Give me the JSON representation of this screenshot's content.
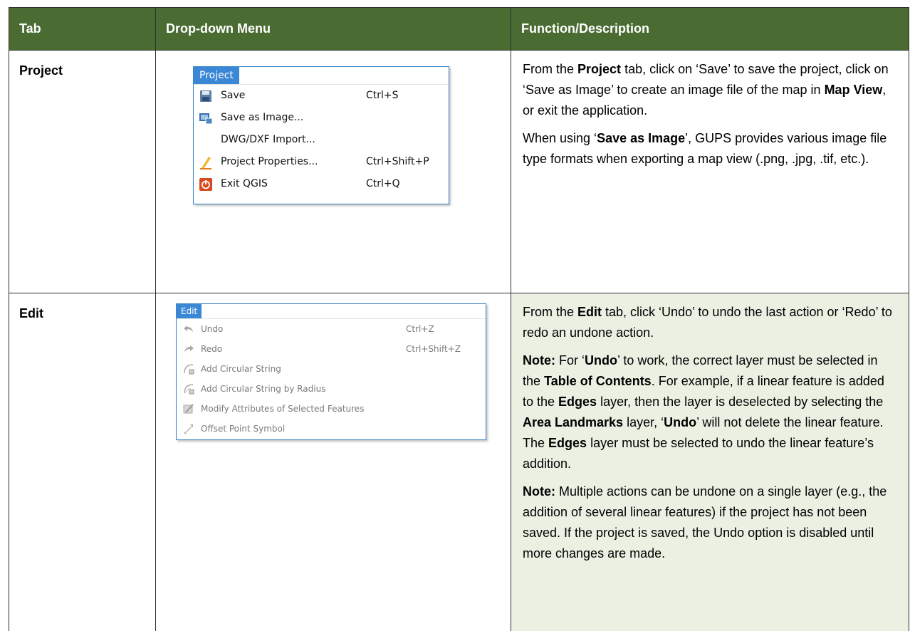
{
  "table": {
    "headers": [
      "Tab",
      "Drop-down Menu",
      "Function/Description"
    ]
  },
  "rows": {
    "project": {
      "tab": "Project",
      "menu": {
        "title": "Project",
        "items": [
          {
            "icon": "save-icon",
            "label": "Save",
            "shortcut": "Ctrl+S"
          },
          {
            "icon": "save-as-image-icon",
            "label": "Save as Image...",
            "shortcut": ""
          },
          {
            "icon": "",
            "label": "DWG/DXF Import...",
            "shortcut": ""
          },
          {
            "icon": "project-properties-icon",
            "label": "Project Properties...",
            "shortcut": "Ctrl+Shift+P"
          },
          {
            "icon": "exit-icon",
            "label": "Exit QGIS",
            "shortcut": "Ctrl+Q"
          }
        ]
      },
      "desc": {
        "p1": [
          {
            "text": "From the ",
            "bold": false
          },
          {
            "text": "Project",
            "bold": true
          },
          {
            "text": " tab, click on ‘Save’ to save the project, click on ‘Save as Image’ to create an image file of the map in ",
            "bold": false
          },
          {
            "text": "Map View",
            "bold": true
          },
          {
            "text": ", or exit the application.",
            "bold": false
          }
        ],
        "p2": [
          {
            "text": "When using ‘",
            "bold": false
          },
          {
            "text": "Save as Image",
            "bold": true
          },
          {
            "text": "’, GUPS provides various image file type formats when exporting a map view (.png, .jpg, .tif, etc.).",
            "bold": false
          }
        ]
      }
    },
    "edit": {
      "tab": "Edit",
      "menu": {
        "title": "Edit",
        "items": [
          {
            "icon": "undo-icon",
            "label": "Undo",
            "shortcut": "Ctrl+Z"
          },
          {
            "icon": "redo-icon",
            "label": "Redo",
            "shortcut": "Ctrl+Shift+Z"
          },
          {
            "icon": "circular-string-icon",
            "label": "Add Circular String",
            "shortcut": ""
          },
          {
            "icon": "circular-string-radius-icon",
            "label": "Add Circular String by Radius",
            "shortcut": ""
          },
          {
            "icon": "modify-attributes-icon",
            "label": "Modify Attributes of Selected Features",
            "shortcut": ""
          },
          {
            "icon": "offset-point-icon",
            "label": "Offset Point Symbol",
            "shortcut": ""
          }
        ]
      },
      "desc": {
        "p1": [
          {
            "text": "From the ",
            "bold": false
          },
          {
            "text": "Edit",
            "bold": true
          },
          {
            "text": " tab, click ‘Undo’ to undo the last action or ‘Redo’ to redo an undone action.",
            "bold": false
          }
        ],
        "p2": [
          {
            "text": "Note:",
            "bold": true
          },
          {
            "text": "  For ‘",
            "bold": false
          },
          {
            "text": "Undo",
            "bold": true
          },
          {
            "text": "’ to work, the correct layer must be selected in the ",
            "bold": false
          },
          {
            "text": "Table of Contents",
            "bold": true
          },
          {
            "text": ". For example, if a linear feature is added to the ",
            "bold": false
          },
          {
            "text": "Edges",
            "bold": true
          },
          {
            "text": " layer, then the layer is deselected by selecting the ",
            "bold": false
          },
          {
            "text": "Area Landmarks",
            "bold": true
          },
          {
            "text": " layer, ‘",
            "bold": false
          },
          {
            "text": "Undo",
            "bold": true
          },
          {
            "text": "’ will not delete the linear feature. The ",
            "bold": false
          },
          {
            "text": "Edges",
            "bold": true
          },
          {
            "text": " layer must be selected to undo the linear feature’s addition.",
            "bold": false
          }
        ],
        "p3": [
          {
            "text": "Note:",
            "bold": true
          },
          {
            "text": "  Multiple actions can be undone on a single layer (e.g., the addition of several linear features) if the project has not been saved. If the project is saved, the Undo option is disabled until more changes are made.",
            "bold": false
          }
        ]
      }
    }
  },
  "colors": {
    "header_bg": "#4a6b32",
    "row_shade": "#eaf1e3",
    "menu_accent": "#3a87d6"
  }
}
